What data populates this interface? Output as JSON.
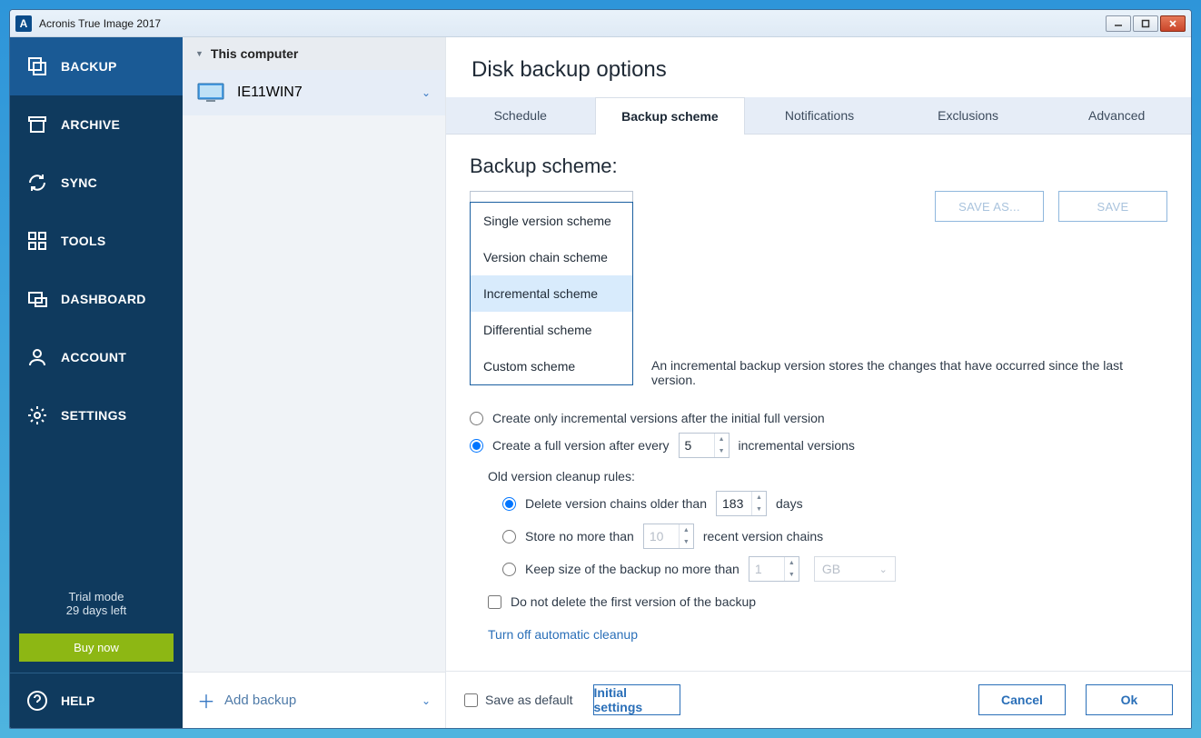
{
  "window": {
    "title": "Acronis True Image 2017"
  },
  "sidebar": {
    "items": [
      {
        "label": "BACKUP"
      },
      {
        "label": "ARCHIVE"
      },
      {
        "label": "SYNC"
      },
      {
        "label": "TOOLS"
      },
      {
        "label": "DASHBOARD"
      },
      {
        "label": "ACCOUNT"
      },
      {
        "label": "SETTINGS"
      }
    ],
    "trial_line1": "Trial mode",
    "trial_line2": "29 days left",
    "buy_now": "Buy now",
    "help": "HELP"
  },
  "col2": {
    "header": "This computer",
    "device": "IE11WIN7",
    "add_backup": "Add backup"
  },
  "main": {
    "title": "Disk backup options",
    "tabs": [
      {
        "label": "Schedule"
      },
      {
        "label": "Backup scheme"
      },
      {
        "label": "Notifications"
      },
      {
        "label": "Exclusions"
      },
      {
        "label": "Advanced"
      }
    ],
    "section_title": "Backup scheme:",
    "selected_scheme": "Incremental scheme",
    "save_as": "SAVE AS...",
    "save": "SAVE",
    "dropdown": [
      "Single version scheme",
      "Version chain scheme",
      "Incremental scheme",
      "Differential scheme",
      "Custom scheme"
    ],
    "description": "An incremental backup version stores the changes that have occurred since the last version.",
    "opts": {
      "r1": "Create only incremental versions after the initial full version",
      "r2a": "Create a full version after every",
      "r2_val": "5",
      "r2b": "incremental versions",
      "cleanup_heading": "Old version cleanup rules:",
      "c1a": "Delete version chains older than",
      "c1_val": "183",
      "c1b": "days",
      "c2a": "Store no more than",
      "c2_val": "10",
      "c2b": "recent version chains",
      "c3a": "Keep size of the backup no more than",
      "c3_val": "1",
      "c3_unit": "GB",
      "cb1": "Do not delete the first version of the backup",
      "link": "Turn off automatic cleanup"
    },
    "footer": {
      "save_default": "Save as default",
      "initial_settings": "Initial settings",
      "cancel": "Cancel",
      "ok": "Ok"
    }
  }
}
